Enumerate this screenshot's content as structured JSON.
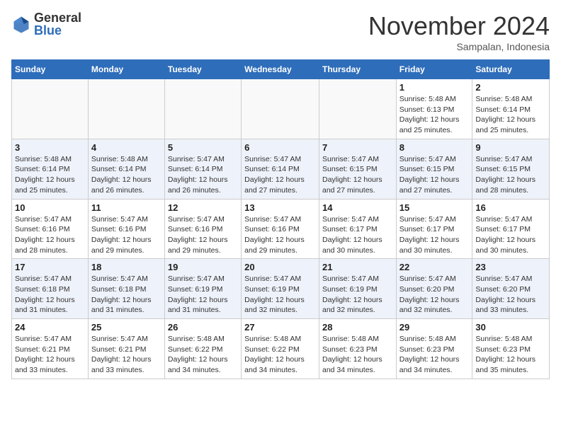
{
  "logo": {
    "general": "General",
    "blue": "Blue"
  },
  "title": "November 2024",
  "location": "Sampalan, Indonesia",
  "days_of_week": [
    "Sunday",
    "Monday",
    "Tuesday",
    "Wednesday",
    "Thursday",
    "Friday",
    "Saturday"
  ],
  "weeks": [
    [
      {
        "day": "",
        "info": ""
      },
      {
        "day": "",
        "info": ""
      },
      {
        "day": "",
        "info": ""
      },
      {
        "day": "",
        "info": ""
      },
      {
        "day": "",
        "info": ""
      },
      {
        "day": "1",
        "info": "Sunrise: 5:48 AM\nSunset: 6:13 PM\nDaylight: 12 hours and 25 minutes."
      },
      {
        "day": "2",
        "info": "Sunrise: 5:48 AM\nSunset: 6:14 PM\nDaylight: 12 hours and 25 minutes."
      }
    ],
    [
      {
        "day": "3",
        "info": "Sunrise: 5:48 AM\nSunset: 6:14 PM\nDaylight: 12 hours and 25 minutes."
      },
      {
        "day": "4",
        "info": "Sunrise: 5:48 AM\nSunset: 6:14 PM\nDaylight: 12 hours and 26 minutes."
      },
      {
        "day": "5",
        "info": "Sunrise: 5:47 AM\nSunset: 6:14 PM\nDaylight: 12 hours and 26 minutes."
      },
      {
        "day": "6",
        "info": "Sunrise: 5:47 AM\nSunset: 6:14 PM\nDaylight: 12 hours and 27 minutes."
      },
      {
        "day": "7",
        "info": "Sunrise: 5:47 AM\nSunset: 6:15 PM\nDaylight: 12 hours and 27 minutes."
      },
      {
        "day": "8",
        "info": "Sunrise: 5:47 AM\nSunset: 6:15 PM\nDaylight: 12 hours and 27 minutes."
      },
      {
        "day": "9",
        "info": "Sunrise: 5:47 AM\nSunset: 6:15 PM\nDaylight: 12 hours and 28 minutes."
      }
    ],
    [
      {
        "day": "10",
        "info": "Sunrise: 5:47 AM\nSunset: 6:16 PM\nDaylight: 12 hours and 28 minutes."
      },
      {
        "day": "11",
        "info": "Sunrise: 5:47 AM\nSunset: 6:16 PM\nDaylight: 12 hours and 29 minutes."
      },
      {
        "day": "12",
        "info": "Sunrise: 5:47 AM\nSunset: 6:16 PM\nDaylight: 12 hours and 29 minutes."
      },
      {
        "day": "13",
        "info": "Sunrise: 5:47 AM\nSunset: 6:16 PM\nDaylight: 12 hours and 29 minutes."
      },
      {
        "day": "14",
        "info": "Sunrise: 5:47 AM\nSunset: 6:17 PM\nDaylight: 12 hours and 30 minutes."
      },
      {
        "day": "15",
        "info": "Sunrise: 5:47 AM\nSunset: 6:17 PM\nDaylight: 12 hours and 30 minutes."
      },
      {
        "day": "16",
        "info": "Sunrise: 5:47 AM\nSunset: 6:17 PM\nDaylight: 12 hours and 30 minutes."
      }
    ],
    [
      {
        "day": "17",
        "info": "Sunrise: 5:47 AM\nSunset: 6:18 PM\nDaylight: 12 hours and 31 minutes."
      },
      {
        "day": "18",
        "info": "Sunrise: 5:47 AM\nSunset: 6:18 PM\nDaylight: 12 hours and 31 minutes."
      },
      {
        "day": "19",
        "info": "Sunrise: 5:47 AM\nSunset: 6:19 PM\nDaylight: 12 hours and 31 minutes."
      },
      {
        "day": "20",
        "info": "Sunrise: 5:47 AM\nSunset: 6:19 PM\nDaylight: 12 hours and 32 minutes."
      },
      {
        "day": "21",
        "info": "Sunrise: 5:47 AM\nSunset: 6:19 PM\nDaylight: 12 hours and 32 minutes."
      },
      {
        "day": "22",
        "info": "Sunrise: 5:47 AM\nSunset: 6:20 PM\nDaylight: 12 hours and 32 minutes."
      },
      {
        "day": "23",
        "info": "Sunrise: 5:47 AM\nSunset: 6:20 PM\nDaylight: 12 hours and 33 minutes."
      }
    ],
    [
      {
        "day": "24",
        "info": "Sunrise: 5:47 AM\nSunset: 6:21 PM\nDaylight: 12 hours and 33 minutes."
      },
      {
        "day": "25",
        "info": "Sunrise: 5:47 AM\nSunset: 6:21 PM\nDaylight: 12 hours and 33 minutes."
      },
      {
        "day": "26",
        "info": "Sunrise: 5:48 AM\nSunset: 6:22 PM\nDaylight: 12 hours and 34 minutes."
      },
      {
        "day": "27",
        "info": "Sunrise: 5:48 AM\nSunset: 6:22 PM\nDaylight: 12 hours and 34 minutes."
      },
      {
        "day": "28",
        "info": "Sunrise: 5:48 AM\nSunset: 6:23 PM\nDaylight: 12 hours and 34 minutes."
      },
      {
        "day": "29",
        "info": "Sunrise: 5:48 AM\nSunset: 6:23 PM\nDaylight: 12 hours and 34 minutes."
      },
      {
        "day": "30",
        "info": "Sunrise: 5:48 AM\nSunset: 6:23 PM\nDaylight: 12 hours and 35 minutes."
      }
    ]
  ]
}
